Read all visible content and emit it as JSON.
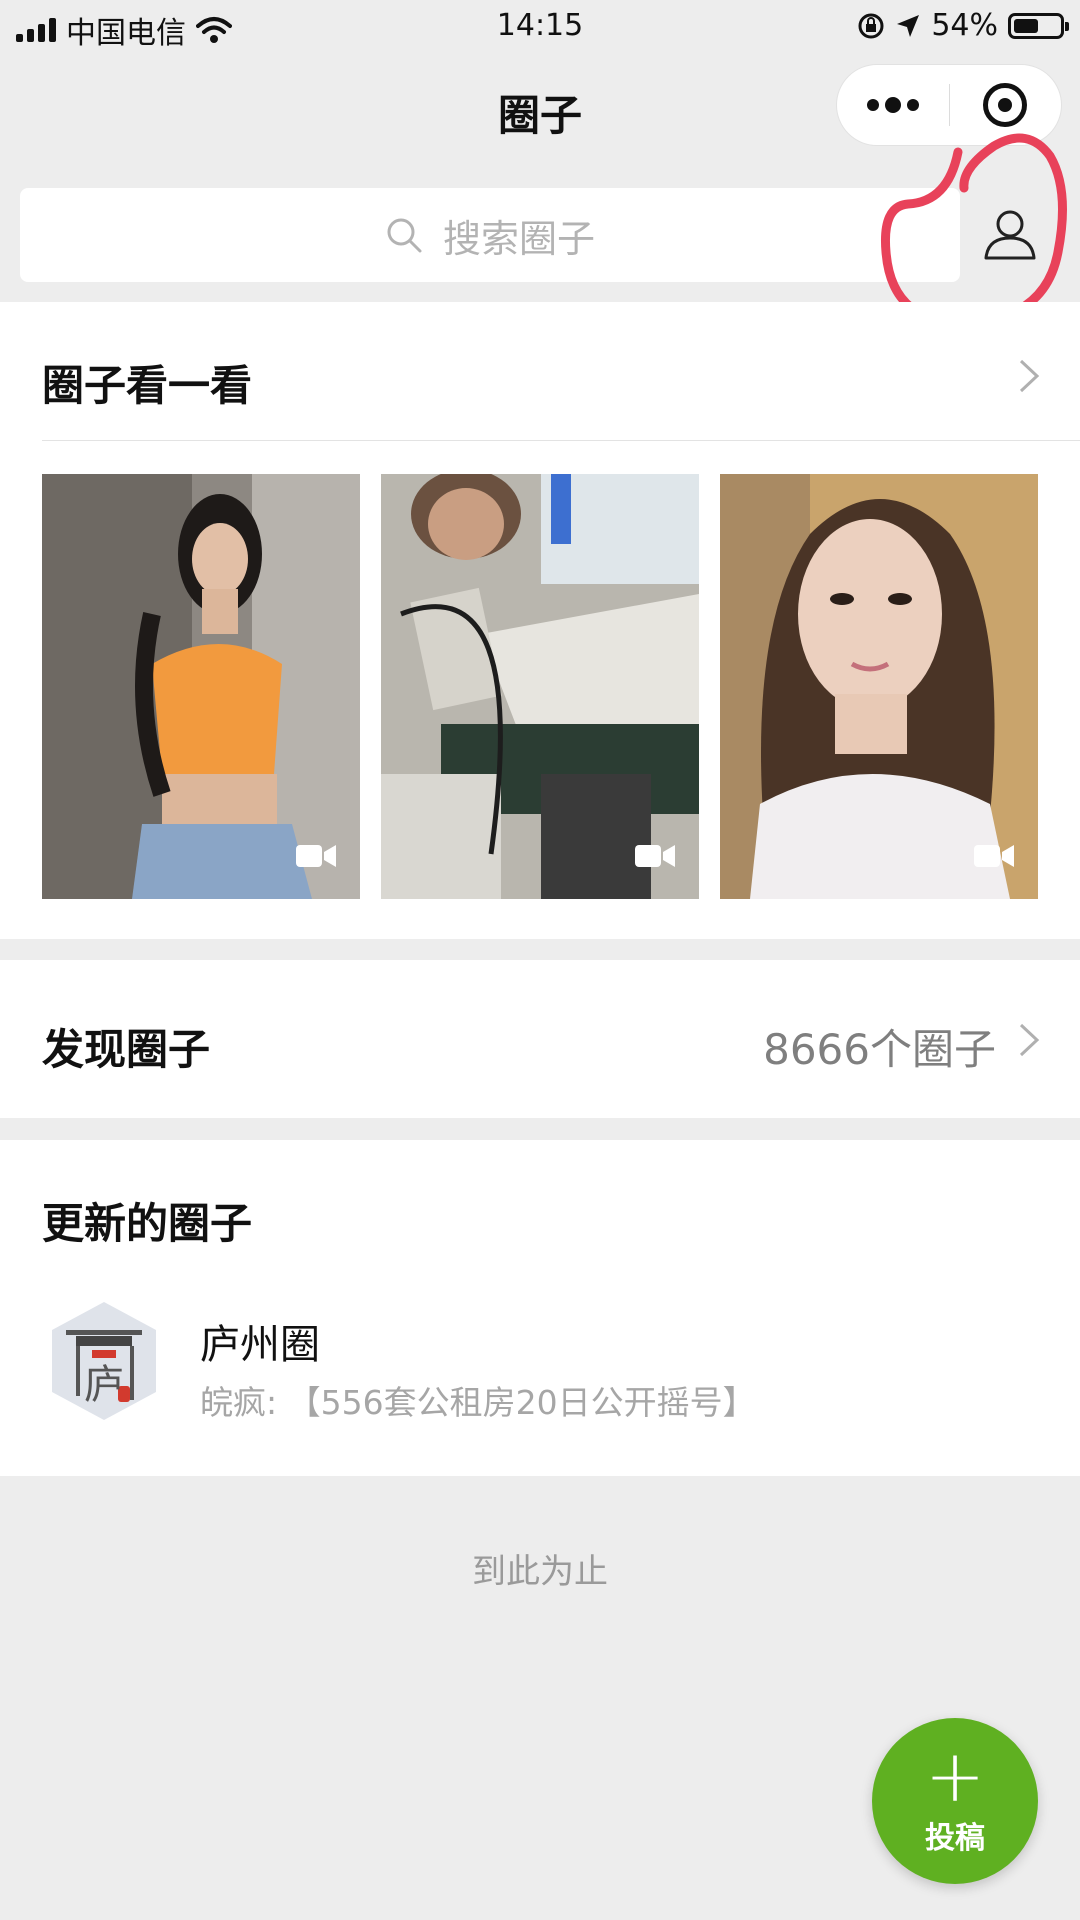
{
  "status_bar": {
    "carrier": "中国电信",
    "time": "14:15",
    "battery": "54%",
    "battery_level": 0.54
  },
  "nav": {
    "title": "圈子"
  },
  "search": {
    "placeholder": "搜索圈子"
  },
  "look_section": {
    "title": "圈子看一看",
    "thumbnails": [
      {
        "kind": "video"
      },
      {
        "kind": "video"
      },
      {
        "kind": "video"
      }
    ]
  },
  "discover_section": {
    "title": "发现圈子",
    "count": "8666个圈子"
  },
  "updated_section": {
    "title": "更新的圈子",
    "items": [
      {
        "name": "庐州圈",
        "latest": "皖疯: 【556套公租房20日公开摇号】",
        "avatar_char": "庐"
      }
    ]
  },
  "end_text": "到此为止",
  "fab": {
    "plus": "+",
    "label": "投稿"
  },
  "colors": {
    "accent_green": "#5fb021",
    "annotation_red": "#e8425a",
    "background": "#ededed"
  }
}
